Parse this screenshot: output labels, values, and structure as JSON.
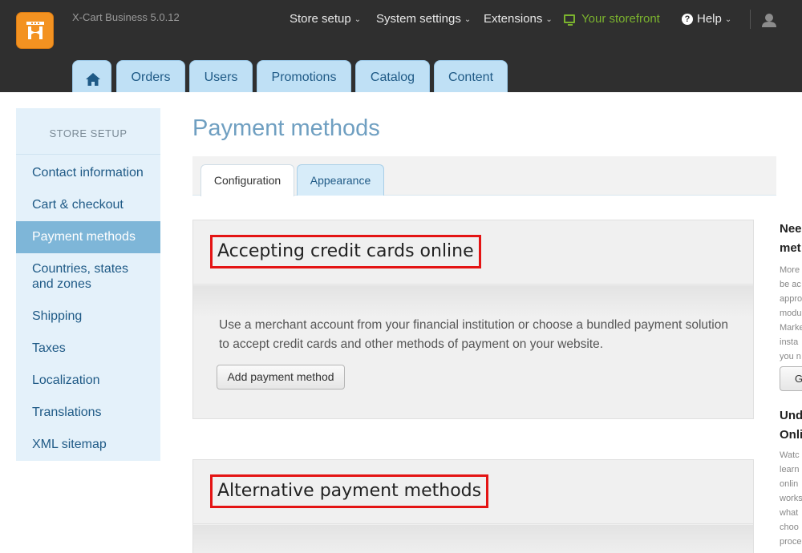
{
  "app": {
    "version": "X-Cart Business 5.0.12"
  },
  "topnav": {
    "store_setup": "Store setup",
    "system_settings": "System settings",
    "extensions": "Extensions",
    "storefront": "Your storefront",
    "help": "Help"
  },
  "main_tabs": [
    "Orders",
    "Users",
    "Promotions",
    "Catalog",
    "Content"
  ],
  "sidebar": {
    "title": "STORE SETUP",
    "items": [
      {
        "label": "Contact information"
      },
      {
        "label": "Cart & checkout"
      },
      {
        "label": "Payment methods"
      },
      {
        "label": "Countries, states"
      },
      {
        "label": "and zones"
      },
      {
        "label": "Shipping"
      },
      {
        "label": "Taxes"
      },
      {
        "label": "Localization"
      },
      {
        "label": "Translations"
      },
      {
        "label": "XML sitemap"
      }
    ]
  },
  "page": {
    "title": "Payment methods",
    "subtabs": [
      "Configuration",
      "Appearance"
    ],
    "active_subtab": "Configuration"
  },
  "panels": {
    "credit_cards": {
      "heading": "Accepting credit cards online",
      "description": "Use a merchant account from your financial institution or choose a bundled payment solution to accept credit cards and other methods of payment on your website.",
      "button": "Add payment method"
    },
    "alternative": {
      "heading": "Alternative payment methods"
    }
  },
  "right_column": {
    "block1_title_lines": [
      "Nee",
      "met"
    ],
    "block1_text_lines": [
      "More",
      "be ac",
      "appro",
      "modu",
      "Marke",
      "insta",
      "you n"
    ],
    "block1_button": "G",
    "block2_title_lines": [
      "Und",
      "Onli"
    ],
    "block2_text_lines": [
      "Watc",
      "learn",
      "onlin",
      "works",
      "what",
      "choo",
      "proce"
    ]
  },
  "colors": {
    "topbar": "#2f2f2f",
    "accent": "#7eb6d8",
    "tab_bg": "#bfe0f5",
    "storefront_green": "#7bb32e",
    "logo_orange": "#f39221",
    "highlight_red": "#e41414"
  },
  "icons": {
    "logo": "xcart-logo-icon",
    "home": "home-icon",
    "monitor": "monitor-icon",
    "help": "question-circle-icon",
    "user": "user-icon"
  }
}
